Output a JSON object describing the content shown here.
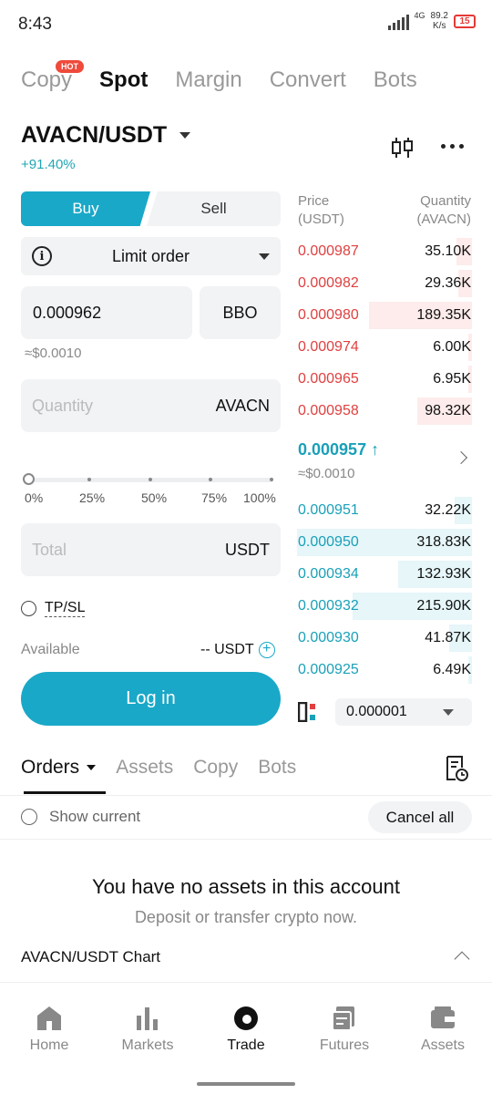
{
  "status_bar": {
    "time": "8:43",
    "network": "4G",
    "speed_value": "89.2",
    "speed_unit": "K/s",
    "battery": "15"
  },
  "top_tabs": [
    {
      "label": "Copy",
      "badge": "HOT",
      "active": false
    },
    {
      "label": "Spot",
      "active": true
    },
    {
      "label": "Margin",
      "active": false
    },
    {
      "label": "Convert",
      "active": false
    },
    {
      "label": "Bots",
      "active": false
    }
  ],
  "pair": {
    "symbol": "AVACN/USDT",
    "change": "+91.40%"
  },
  "trade_form": {
    "buy_label": "Buy",
    "sell_label": "Sell",
    "order_type": "Limit order",
    "price_value": "0.000962",
    "bbo_label": "BBO",
    "price_approx": "≈$0.0010",
    "quantity_placeholder": "Quantity",
    "quantity_unit": "AVACN",
    "slider_labels": [
      "0%",
      "25%",
      "50%",
      "75%",
      "100%"
    ],
    "slider_value": 0,
    "total_placeholder": "Total",
    "total_unit": "USDT",
    "tpsl_label": "TP/SL",
    "available_label": "Available",
    "available_value": "-- USDT",
    "login_label": "Log in"
  },
  "order_book": {
    "price_header_1": "Price",
    "price_header_2": "(USDT)",
    "qty_header_1": "Quantity",
    "qty_header_2": "(AVACN)",
    "asks": [
      {
        "price": "0.000987",
        "qty": "35.10K",
        "depth": 0.09
      },
      {
        "price": "0.000982",
        "qty": "29.36K",
        "depth": 0.08
      },
      {
        "price": "0.000980",
        "qty": "189.35K",
        "depth": 0.59
      },
      {
        "price": "0.000974",
        "qty": "6.00K",
        "depth": 0.02
      },
      {
        "price": "0.000965",
        "qty": "6.95K",
        "depth": 0.02
      },
      {
        "price": "0.000958",
        "qty": "98.32K",
        "depth": 0.31
      }
    ],
    "last_price": "0.000957",
    "last_approx": "≈$0.0010",
    "bids": [
      {
        "price": "0.000951",
        "qty": "32.22K",
        "depth": 0.1
      },
      {
        "price": "0.000950",
        "qty": "318.83K",
        "depth": 1.0
      },
      {
        "price": "0.000934",
        "qty": "132.93K",
        "depth": 0.42
      },
      {
        "price": "0.000932",
        "qty": "215.90K",
        "depth": 0.68
      },
      {
        "price": "0.000930",
        "qty": "41.87K",
        "depth": 0.13
      },
      {
        "price": "0.000925",
        "qty": "6.49K",
        "depth": 0.02
      }
    ],
    "precision": "0.000001"
  },
  "orders_section": {
    "tabs": [
      {
        "label": "Orders",
        "active": true
      },
      {
        "label": "Assets",
        "active": false
      },
      {
        "label": "Copy",
        "active": false
      },
      {
        "label": "Bots",
        "active": false
      }
    ],
    "show_current_label": "Show current",
    "cancel_all_label": "Cancel all",
    "empty_title": "You have no assets in this account",
    "empty_subtitle": "Deposit or transfer crypto now.",
    "chart_row_label": "AVACN/USDT Chart"
  },
  "bottom_nav": [
    {
      "label": "Home",
      "icon": "home-icon",
      "active": false
    },
    {
      "label": "Markets",
      "icon": "markets-icon",
      "active": false
    },
    {
      "label": "Trade",
      "icon": "trade-icon",
      "active": true
    },
    {
      "label": "Futures",
      "icon": "futures-icon",
      "active": false
    },
    {
      "label": "Assets",
      "icon": "assets-icon",
      "active": false
    }
  ],
  "colors": {
    "accent": "#1aa8c8",
    "ask": "#e0403f",
    "bid": "#1aa0b8",
    "hot": "#ef4a3b"
  }
}
